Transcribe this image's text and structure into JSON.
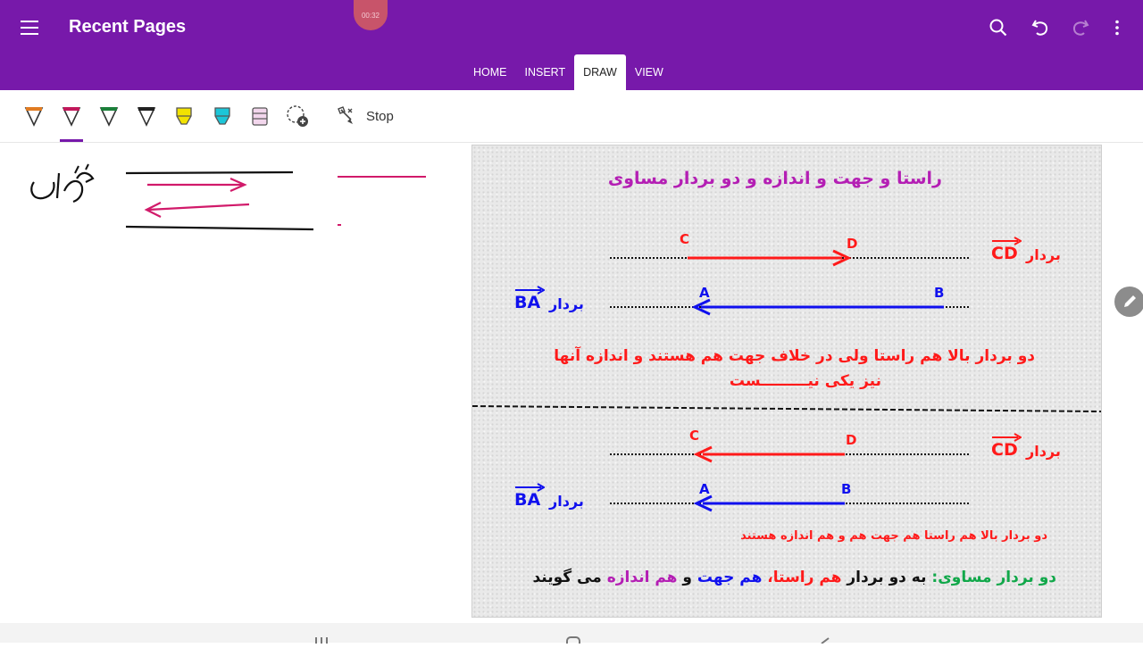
{
  "header": {
    "title": "Recent Pages",
    "timer": "00:32",
    "tabs": [
      {
        "label": "HOME",
        "active": false
      },
      {
        "label": "INSERT",
        "active": false
      },
      {
        "label": "DRAW",
        "active": true
      },
      {
        "label": "VIEW",
        "active": false
      }
    ]
  },
  "toolbar": {
    "pens": [
      {
        "name": "orange-pen",
        "color": "#e07b22"
      },
      {
        "name": "magenta-pen",
        "color": "#c2185b"
      },
      {
        "name": "green-pen",
        "color": "#1b7f3a"
      },
      {
        "name": "black-pen",
        "color": "#222222"
      },
      {
        "name": "yellow-highlighter",
        "color": "#f2e200"
      },
      {
        "name": "cyan-highlighter",
        "color": "#1cc6d8"
      },
      {
        "name": "pink-highlighter",
        "color": "#e6a8d6"
      }
    ],
    "stop_label": "Stop"
  },
  "colors": {
    "accent": "#7719aa",
    "red": "#ff1a1a",
    "blue": "#1010ee",
    "purple": "#b41fb4",
    "green": "#11a84a"
  },
  "slide": {
    "title": "راستا و جهت و اندازه و دو بردار مساوی",
    "vector_word": "بردار",
    "cd": "CD",
    "ba": "BA",
    "pt_c": "C",
    "pt_d": "D",
    "pt_a": "A",
    "pt_b": "B",
    "note1_line1": "دو بردار بالا هم راستا ولی در خلاف جهت هم هستند و اندازه آنها",
    "note1_line2": "نیز یکی نیـــــــــست",
    "note2": "دو بردار بالا هم راستا هم جهت هم و هم اندازه هستند",
    "def_label": "دو بردار مساوی:",
    "def_a": "به دو بردار",
    "def_b": "هم راستا،",
    "def_c": "هم جهت",
    "def_d": "و",
    "def_e": "هم اندازه",
    "def_f": "می گویند"
  }
}
